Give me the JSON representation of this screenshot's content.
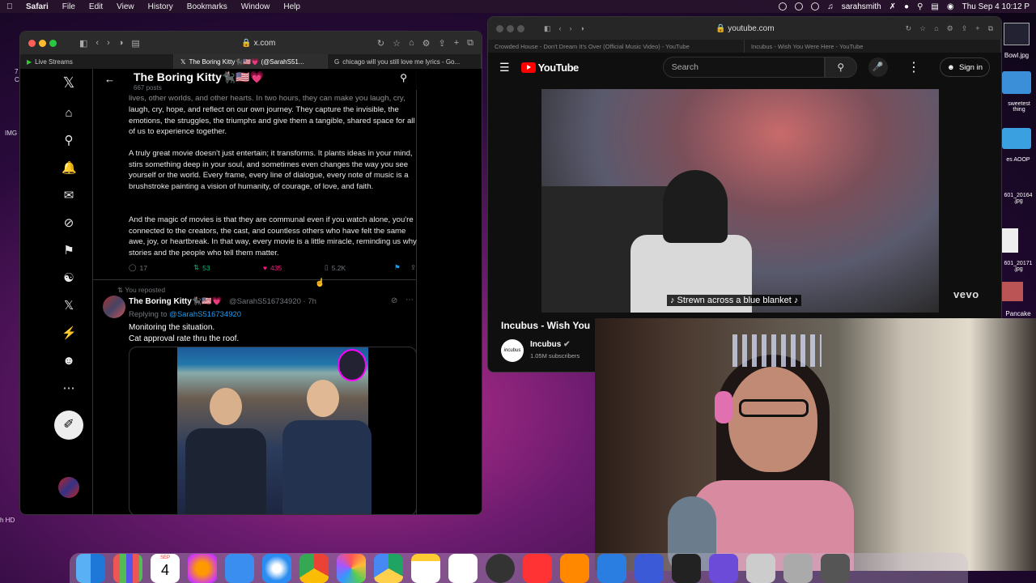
{
  "menubar": {
    "app": "Safari",
    "menus": [
      "File",
      "Edit",
      "View",
      "History",
      "Bookmarks",
      "Window",
      "Help"
    ],
    "user": "sarahsmith",
    "datetime": "Thu Sep 4  10:12 P"
  },
  "desktop": {
    "left_labels": [
      "7",
      "C",
      "IMG",
      "h HD"
    ],
    "right_files": [
      "Bowl.jpg",
      "sweetest thing",
      "es AOOP",
      "601_20164 .jpg",
      "601_20171 .jpg",
      "Pancake"
    ]
  },
  "safari_x": {
    "url": "x.com",
    "tabs": [
      "Live Streams",
      "The Boring Kitty🐈‍⬛🇺🇸💗 (@SarahS51...",
      "chicago will you still love me lyrics - Go..."
    ],
    "profile": {
      "name": "The Boring Kitty🐈‍⬛🇺🇸💗",
      "posts": "667 posts"
    },
    "tweet": {
      "paragraph0": "lives, other worlds, and other hearts. In two hours, they can make you laugh, cry, hope, and reflect on our own journey. They capture the invisible, the emotions, the struggles, the triumphs and give them a tangible, shared space for all of us to experience together.",
      "paragraph1": "A truly great movie doesn't just entertain; it transforms. It plants ideas in your mind, stirs something deep in your soul, and sometimes even changes the way you see yourself or the world. Every frame, every line of dialogue, every note of music is a brushstroke painting a vision of humanity, of courage, of love, and faith.",
      "paragraph2": "And the magic of movies is that they are communal even if you watch alone, you're connected to the creators, the cast, and countless others who have felt the same awe, joy, or heartbreak. In that way, every movie is a little miracle, reminding us why stories and the people who tell them matter.",
      "replies": "17",
      "reposts": "53",
      "likes": "435",
      "views": "5.2K"
    },
    "repost": {
      "label": "You reposted",
      "name": "The Boring Kitty🐈‍⬛🇺🇸💗",
      "handle": "@SarahS516734920 · 7h",
      "replying_prefix": "Replying to ",
      "replying_to": "@SarahS516734920",
      "text_line1": "Monitoring the situation.",
      "text_line2": "Cat approval rate thru the roof."
    }
  },
  "safari_yt": {
    "url": "youtube.com",
    "tabs": [
      "Crowded House - Don't Dream It's Over (Official Music Video) - YouTube",
      "Incubus - Wish You Were Here - YouTube"
    ],
    "search_placeholder": "Search",
    "signin": "Sign in",
    "logo": "YouTube",
    "caption": "♪ Strewn across a blue blanket ♪",
    "watermark": "vevo",
    "title": "Incubus - Wish You",
    "channel": "Incubus",
    "channel_avatar_text": "incubus",
    "subscribers": "1.05M subscribers"
  },
  "dock": {
    "calendar_month": "SEP",
    "calendar_day": "4",
    "apps": [
      "Finder",
      "Launchpad",
      "Calendar",
      "Firefox",
      "Mail",
      "Safari",
      "Chrome",
      "Photos",
      "Drive",
      "Notes",
      "Freeform",
      "OBS",
      "News",
      "Sublime"
    ]
  }
}
